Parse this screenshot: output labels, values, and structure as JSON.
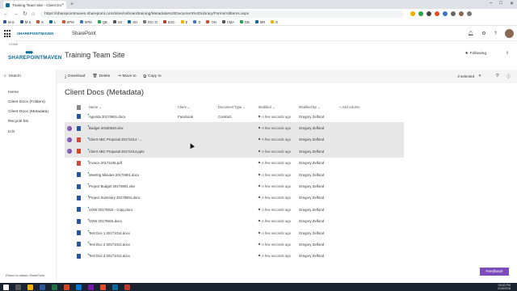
{
  "browser": {
    "tab_title": "Training Team Site - Client Doc",
    "tab_close": "×",
    "new_tab": "+",
    "url": "https://sharepointmaven.sharepoint.com/sites/onboardtraining/Metadata%20Document%20Library/Forms/AllItems.aspx",
    "bookmarks": [
      "M-S",
      "M-S",
      "K",
      "L",
      "SPM",
      "SPM",
      "QB",
      "SS",
      "SH",
      "IDC-O",
      "ESC",
      "E",
      "D",
      "ON",
      "CMA",
      "DB",
      "MR",
      "E"
    ]
  },
  "suitebar": {
    "app_name": "SharePoint",
    "logo_text": "SHAREPOINTMAVEN"
  },
  "site": {
    "home_link": "HOME",
    "logo_word": "SHAREPOINTMAVEN",
    "title": "Training Team Site",
    "following": "Following",
    "share": "Share"
  },
  "leftnav": {
    "search": "Search",
    "items": [
      "Home",
      "Client Docs (Folders)",
      "Client Docs (Metadata)",
      "Recycle bin",
      "Edit"
    ],
    "classic_link": "Return to classic SharePoint"
  },
  "commandbar": {
    "download": "Download",
    "delete": "Delete",
    "move_to": "Move to",
    "copy_to": "Copy to",
    "selected": "3 selected"
  },
  "library": {
    "title": "Client Docs (Metadata)",
    "columns": {
      "name": "Name",
      "client": "Client",
      "doctype": "Document Type",
      "modified": "Modified",
      "modified_by": "Modified By",
      "add_column": "+ Add column"
    },
    "rows": [
      {
        "name": "Agenda 20170801.docx",
        "client": "Facebook",
        "doctype": "Contract",
        "modified": "A few seconds ago",
        "modified_by": "Gregory Zelfond",
        "type": "word",
        "selected": false
      },
      {
        "name": "Budget 20180520.xlsx",
        "client": "",
        "doctype": "",
        "modified": "A few seconds ago",
        "modified_by": "Gregory Zelfond",
        "type": "word",
        "selected": true
      },
      {
        "name": "Client ABC Proposal 20171014 - ...",
        "client": "",
        "doctype": "",
        "modified": "A few seconds ago",
        "modified_by": "Gregory Zelfond",
        "type": "pdf",
        "selected": true
      },
      {
        "name": "Client ABC Proposal 20171014.pptx",
        "client": "",
        "doctype": "",
        "modified": "A few seconds ago",
        "modified_by": "Gregory Zelfond",
        "type": "pptx",
        "selected": true
      },
      {
        "name": "Invoice 20171105.pdf",
        "client": "",
        "doctype": "",
        "modified": "A few seconds ago",
        "modified_by": "Gregory Zelfond",
        "type": "pdf",
        "selected": false
      },
      {
        "name": "Meeting Minutes 20170801.docx",
        "client": "",
        "doctype": "",
        "modified": "A few seconds ago",
        "modified_by": "Gregory Zelfond",
        "type": "word",
        "selected": false
      },
      {
        "name": "Project Budget 20170801.xlsx",
        "client": "",
        "doctype": "",
        "modified": "A few seconds ago",
        "modified_by": "Gregory Zelfond",
        "type": "word",
        "selected": false
      },
      {
        "name": "Project Summary 20170801.docx",
        "client": "",
        "doctype": "",
        "modified": "A few seconds ago",
        "modified_by": "Gregory Zelfond",
        "type": "word",
        "selected": false
      },
      {
        "name": "SOW 20170815 - Copy.docx",
        "client": "",
        "doctype": "",
        "modified": "A few seconds ago",
        "modified_by": "Gregory Zelfond",
        "type": "word",
        "selected": false
      },
      {
        "name": "SOW 20170815.docx",
        "client": "",
        "doctype": "",
        "modified": "A few seconds ago",
        "modified_by": "Gregory Zelfond",
        "type": "word",
        "selected": false
      },
      {
        "name": "Test Doc 1 20171014.docx",
        "client": "",
        "doctype": "",
        "modified": "A few seconds ago",
        "modified_by": "Gregory Zelfond",
        "type": "word",
        "selected": false
      },
      {
        "name": "Test Doc 2 20171014.docx",
        "client": "",
        "doctype": "",
        "modified": "A few seconds ago",
        "modified_by": "Gregory Zelfond",
        "type": "word",
        "selected": false
      },
      {
        "name": "Test Doc 3 20171014.docx",
        "client": "",
        "doctype": "",
        "modified": "A few seconds ago",
        "modified_by": "Gregory Zelfond",
        "type": "word",
        "selected": false
      }
    ]
  },
  "feedback": "Feedback",
  "taskbar": {
    "time": "09:00 PM",
    "date": "2/18/2018"
  },
  "colors": {
    "accent_purple": "#7c4dba",
    "brand_blue": "#0b6a9a",
    "selected_row": "#e7e7e7"
  }
}
